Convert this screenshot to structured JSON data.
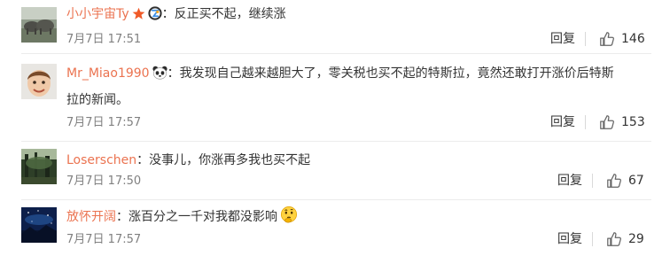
{
  "comments": [
    {
      "username": "小小宇宙Ty",
      "colon": "：",
      "text": "反正买不起，继续涨",
      "text_line2": "",
      "date": "7月7日 17:51",
      "reply_label": "回复",
      "likes": "146",
      "badges": [
        "star-icon",
        "member-badge-icon"
      ],
      "avatar": "elephants-photo-avatar"
    },
    {
      "username": "Mr_Miao1990",
      "colon": "：",
      "text": "我发现自己越来越胆大了，零关税也买不起的特斯拉，竟然还敢打开涨价后特斯",
      "text_line2": "拉的新闻。",
      "date": "7月7日 17:57",
      "reply_label": "回复",
      "likes": "153",
      "badges": [
        "panda-emoji-icon"
      ],
      "avatar": "child-face-avatar"
    },
    {
      "username": "Loserschen",
      "colon": "：",
      "text": "没事儿，你涨再多我也买不起",
      "text_line2": "",
      "date": "7月7日 17:50",
      "reply_label": "回复",
      "likes": "67",
      "badges": [],
      "avatar": "forest-photo-avatar"
    },
    {
      "username": "放怀开阔",
      "colon": "：",
      "text": "涨百分之一千对我都没影响",
      "text_line2": "",
      "date": "7月7日 17:57",
      "reply_label": "回复",
      "likes": "29",
      "badges": [
        "thinking-emoji-icon"
      ],
      "avatar": "starry-night-avatar"
    }
  ],
  "colors": {
    "username": "#eb7350",
    "text": "#333333",
    "meta": "#808080",
    "divider": "#ececec"
  }
}
